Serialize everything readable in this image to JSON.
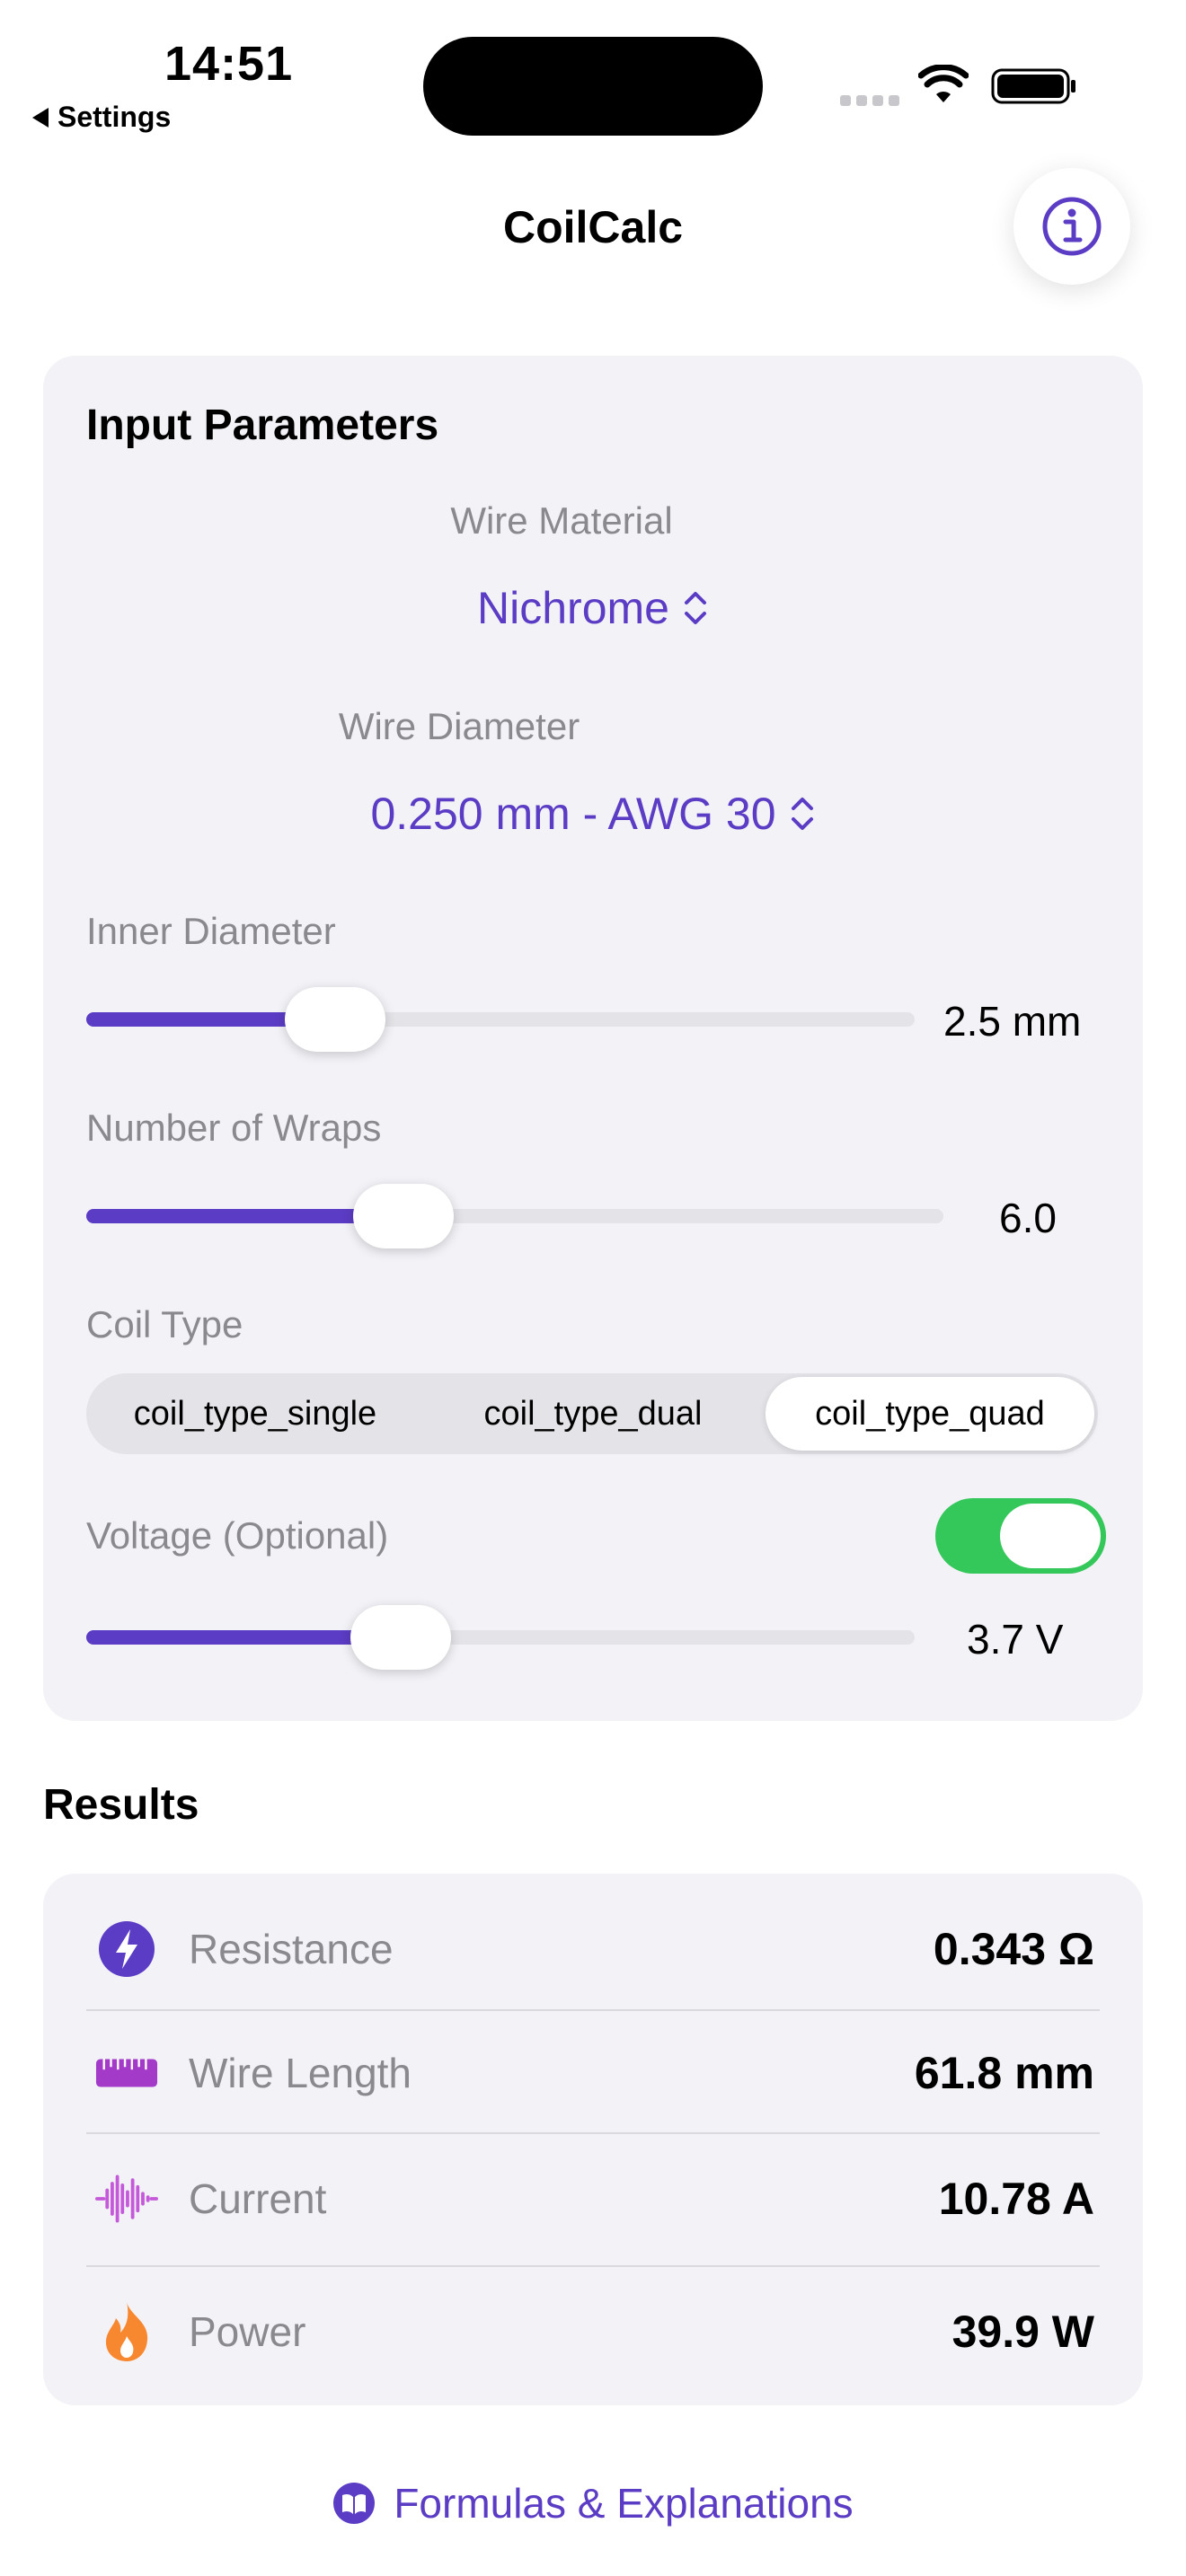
{
  "status_bar": {
    "time": "14:51",
    "back_label": "Settings"
  },
  "nav": {
    "title": "CoilCalc",
    "info_icon": "info-circle-icon"
  },
  "input": {
    "heading": "Input Parameters",
    "wire_material": {
      "label": "Wire Material",
      "value": "Nichrome"
    },
    "wire_diameter": {
      "label": "Wire Diameter",
      "value": "0.250 mm - AWG 30"
    },
    "inner_diameter": {
      "label": "Inner Diameter",
      "value": "2.5 mm",
      "fraction": 0.3
    },
    "wraps": {
      "label": "Number of Wraps",
      "value": "6.0",
      "fraction": 0.37
    },
    "coil_type": {
      "label": "Coil Type",
      "options": [
        "coil_type_single",
        "coil_type_dual",
        "coil_type_quad"
      ],
      "selected": "coil_type_quad"
    },
    "voltage": {
      "label": "Voltage (Optional)",
      "enabled": true,
      "value": "3.7 V",
      "fraction": 0.38
    }
  },
  "results": {
    "heading": "Results",
    "items": [
      {
        "label": "Resistance",
        "value": "0.343 Ω",
        "icon": "bolt-circle-icon"
      },
      {
        "label": "Wire Length",
        "value": "61.8 mm",
        "icon": "ruler-icon"
      },
      {
        "label": "Current",
        "value": "10.78 A",
        "icon": "waveform-icon"
      },
      {
        "label": "Power",
        "value": "39.9 W",
        "icon": "flame-icon"
      }
    ]
  },
  "footer": {
    "link_label": "Formulas & Explanations",
    "icon": "book-circle-icon"
  },
  "colors": {
    "accent": "#5b3cc4",
    "toggle_on": "#34c759",
    "ruler": "#a33bc8",
    "waveform": "#c45ad9",
    "flame": "#f7882f"
  }
}
